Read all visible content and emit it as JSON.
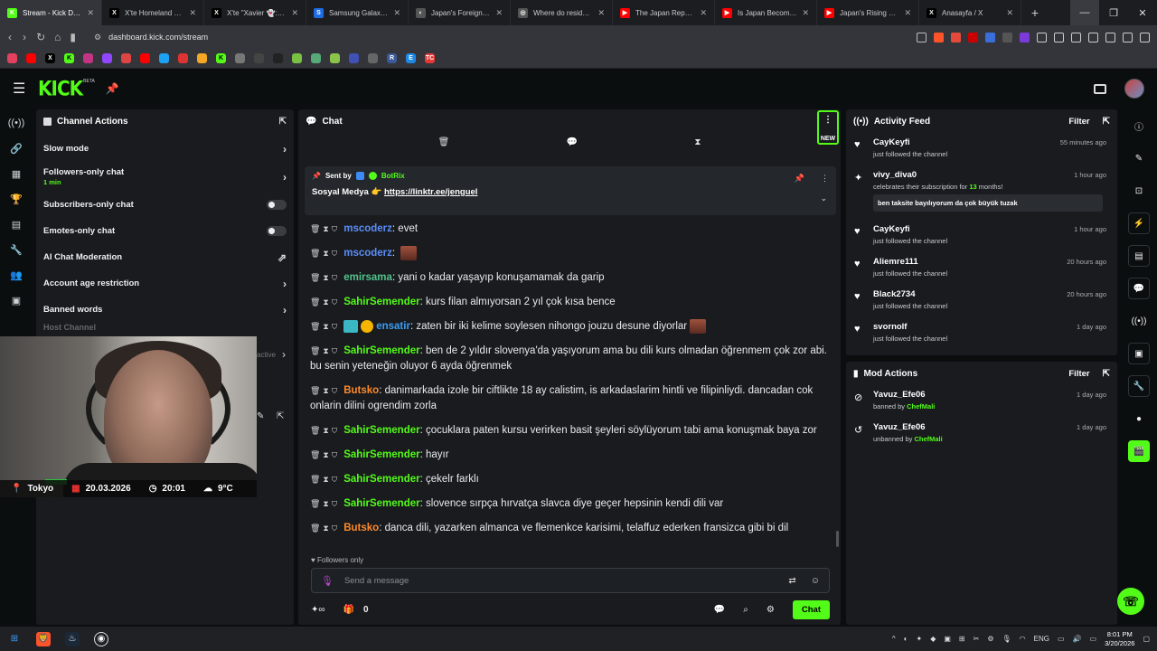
{
  "browser": {
    "tabs": [
      {
        "title": "Stream - Kick Dash",
        "color": "#53fc18",
        "glyph": "K",
        "active": true
      },
      {
        "title": "X'te Homeland Securi",
        "color": "#000000",
        "glyph": "X"
      },
      {
        "title": "X'te \"Xavier 👻: \"Just",
        "color": "#000000",
        "glyph": "X"
      },
      {
        "title": "Samsung Galaxy S26 U",
        "color": "#1e6be6",
        "glyph": "S"
      },
      {
        "title": "Japan's Foreign Popula",
        "color": "#555555",
        "glyph": "◐"
      },
      {
        "title": "Where do resident fore",
        "color": "#555555",
        "glyph": "◎"
      },
      {
        "title": "The Japan Reporter - Y",
        "color": "#ff0000",
        "glyph": "▶"
      },
      {
        "title": "Is Japan Becoming Mo",
        "color": "#ff0000",
        "glyph": "▶"
      },
      {
        "title": "Japan's Rising Reluctan",
        "color": "#ff0000",
        "glyph": "▶"
      },
      {
        "title": "Anasayfa / X",
        "color": "#000000",
        "glyph": "X"
      }
    ],
    "new_tab": "+",
    "url": "dashboard.kick.com/stream"
  },
  "header": {
    "logo": "KICK",
    "beta": "BETA"
  },
  "channel_actions": {
    "title": "Channel Actions",
    "items": [
      {
        "label": "Slow mode",
        "control": "chevron"
      },
      {
        "label": "Followers-only chat",
        "sub": "1 min",
        "control": "chevron"
      },
      {
        "label": "Subscribers-only chat",
        "control": "toggle"
      },
      {
        "label": "Emotes-only chat",
        "control": "toggle"
      },
      {
        "label": "AI Chat Moderation",
        "control": "external"
      },
      {
        "label": "Account age restriction",
        "control": "chevron"
      },
      {
        "label": "Banned words",
        "control": "chevron"
      }
    ],
    "faded_item": "Host Channel",
    "faded_right": "active"
  },
  "overlay": {
    "city": "Tokyo",
    "date": "20.03.2026",
    "time": "20:01",
    "temp": "9°C"
  },
  "chat": {
    "title": "Chat",
    "new_badge": "NEW",
    "pinned": {
      "sent_by": "Sent by",
      "bot": "BotRix",
      "message_prefix": "Sosyal Medya 👉",
      "link": "https://linktr.ee/jenguel"
    },
    "messages": [
      {
        "user": "mscoderz",
        "color": "#5b8df5",
        "text": ": evet"
      },
      {
        "user": "mscoderz",
        "color": "#5b8df5",
        "text": ": "
      },
      {
        "user": "emirsama",
        "color": "#53c28b",
        "text": ": yani o kadar yaşayıp konuşamamak da garip"
      },
      {
        "user": "SahirSemender",
        "color": "#53fc18",
        "text": ": kurs filan almıyorsan 2 yıl çok kısa bence"
      },
      {
        "user": "ensatir",
        "color": "#3b9cf0",
        "text": ": zaten bir iki kelime soylesen nihongo jouzu desune diyorlar"
      },
      {
        "user": "SahirSemender",
        "color": "#53fc18",
        "text": ": ben de 2 yıldır slovenya'da yaşıyorum ama bu dili kurs olmadan öğrenmem çok zor abi. bu senin yeteneğin oluyor 6 ayda öğrenmek"
      },
      {
        "user": "Butsko",
        "color": "#ff8a2a",
        "text": ": danimarkada izole bir ciftlikte 18 ay calistim, is arkadaslarim hintli ve filipinliydi. dancadan cok onlarin dilini ogrendim zorla"
      },
      {
        "user": "SahirSemender",
        "color": "#53fc18",
        "text": ": çocuklara paten kursu verirken basit şeyleri söylüyorum tabi ama konuşmak baya zor"
      },
      {
        "user": "SahirSemender",
        "color": "#53fc18",
        "text": ": hayır"
      },
      {
        "user": "SahirSemender",
        "color": "#53fc18",
        "text": ": çekelr farklı"
      },
      {
        "user": "SahirSemender",
        "color": "#53fc18",
        "text": ": slovence sırpça hırvatça slavca diye geçer hepsinin kendi dili var"
      },
      {
        "user": "Butsko",
        "color": "#ff8a2a",
        "text": ": danca dili, yazarken almanca ve flemenkce karisimi, telaffuz ederken fransizca gibi bi dil"
      }
    ],
    "followers_only": "Followers only",
    "input_placeholder": "Send a message",
    "footer_count": "0",
    "send_label": "Chat"
  },
  "activity_feed": {
    "title": "Activity Feed",
    "filter": "Filter",
    "items": [
      {
        "name": "CayKeyfi",
        "desc": "just followed the channel",
        "time": "55 minutes ago",
        "icon": "heart"
      },
      {
        "name": "vivy_diva0",
        "desc_pre": "celebrates their subscription for ",
        "months": "13",
        "desc_post": " months!",
        "time": "1 hour ago",
        "icon": "sub",
        "message": "ben taksite bayılıyorum da çok büyük tuzak"
      },
      {
        "name": "CayKeyfi",
        "desc": "just followed the channel",
        "time": "1 hour ago",
        "icon": "heart"
      },
      {
        "name": "Aliemre111",
        "desc": "just followed the channel",
        "time": "20 hours ago",
        "icon": "heart"
      },
      {
        "name": "Black2734",
        "desc": "just followed the channel",
        "time": "20 hours ago",
        "icon": "heart"
      },
      {
        "name": "svornolf",
        "desc": "just followed the channel",
        "time": "1 day ago",
        "icon": "heart"
      }
    ]
  },
  "mod_actions": {
    "title": "Mod Actions",
    "filter": "Filter",
    "items": [
      {
        "name": "Yavuz_Efe06",
        "action": "banned by ",
        "by": "ChefMali",
        "time": "1 day ago"
      },
      {
        "name": "Yavuz_Efe06",
        "action": "unbanned by ",
        "by": "ChefMali",
        "time": "1 day ago"
      }
    ]
  },
  "taskbar": {
    "lang": "ENG",
    "time": "8:01 PM",
    "date": "3/20/2026"
  }
}
